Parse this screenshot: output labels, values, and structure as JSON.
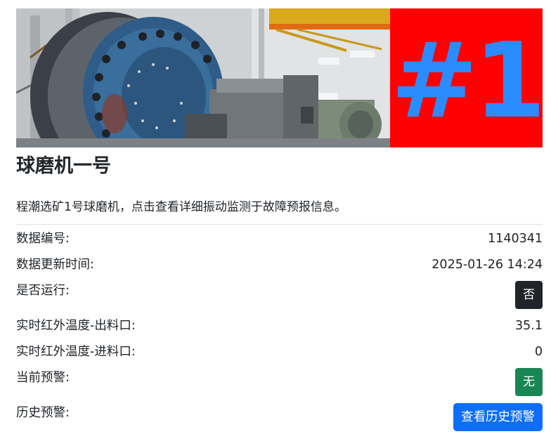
{
  "banner": {
    "badge_text": "#1",
    "badge_bg": "#ff0000",
    "badge_color": "#2a8cff"
  },
  "card": {
    "title": "球磨机一号",
    "description": "程潮选矿1号球磨机，点击查看详细振动监测于故障预报信息。"
  },
  "details": {
    "data_id_label": "数据编号:",
    "data_id_value": "1140341",
    "update_time_label": "数据更新时间:",
    "update_time_value": "2025-01-26 14:24",
    "running_label": "是否运行:",
    "running_value": "否",
    "temp_out_label": "实时红外温度-出料口:",
    "temp_out_value": "35.1",
    "temp_in_label": "实时红外温度-进料口:",
    "temp_in_value": "0",
    "current_alert_label": "当前预警:",
    "current_alert_value": "无",
    "history_alert_label": "历史预警:",
    "history_alert_button": "查看历史预警"
  },
  "colors": {
    "dark_badge": "#212529",
    "success_badge": "#198754",
    "primary_button": "#0d6efd"
  }
}
